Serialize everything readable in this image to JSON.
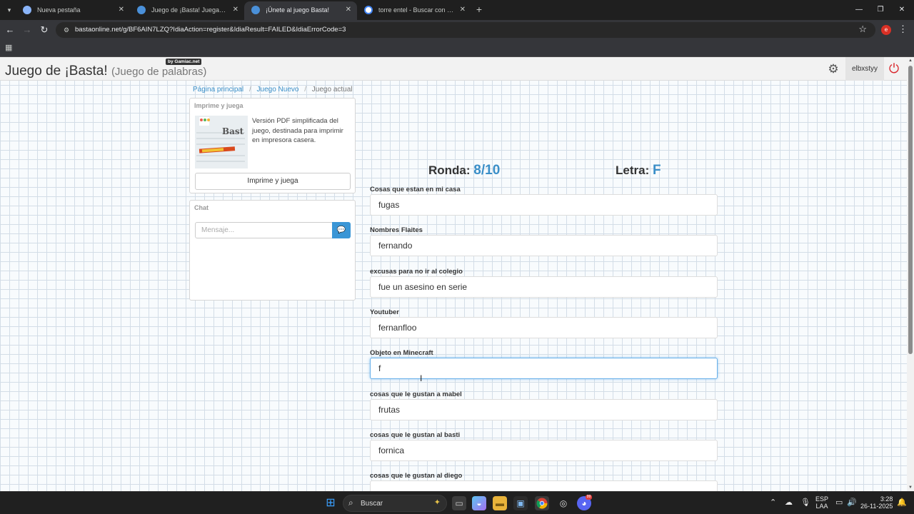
{
  "browser": {
    "tabs": [
      {
        "title": "Nueva pestaña",
        "active": false
      },
      {
        "title": "Juego de ¡Basta! Juega Stop, Tu",
        "active": false
      },
      {
        "title": "¡Únete al juego Basta!",
        "active": true
      },
      {
        "title": "torre entel - Buscar con Google",
        "active": false
      }
    ],
    "url": "bastaonline.net/g/BF6AIN7LZQ?IdiaAction=register&IdiaResult=FAILED&IdiaErrorCode=3",
    "profile_initial": "e"
  },
  "site": {
    "title": "Juego de ¡Basta!",
    "subtitle": "(Juego de palabras)",
    "badge": "by Gamiac.net",
    "username": "elbxstyy"
  },
  "breadcrumb": [
    "Página principal",
    "Juego Nuevo",
    "Juego actual"
  ],
  "print_panel": {
    "heading": "Imprime y juega",
    "description": "Versión PDF simplificada del juego, destinada para imprimir en impresora casera.",
    "button": "Imprime y juega"
  },
  "chat": {
    "heading": "Chat",
    "placeholder": "Mensaje..."
  },
  "game": {
    "round_label": "Ronda:",
    "round_value": "8/10",
    "letter_label": "Letra:",
    "letter_value": "F",
    "fields": [
      {
        "label": "Cosas que estan en mi casa",
        "value": "fugas"
      },
      {
        "label": "Nombres Flaites",
        "value": "fernando"
      },
      {
        "label": "excusas para no ir al colegio",
        "value": "fue un asesino en serie"
      },
      {
        "label": "Youtuber",
        "value": "fernanfloo"
      },
      {
        "label": "Objeto en Minecraft",
        "value": "f",
        "focused": true
      },
      {
        "label": "cosas que le gustan a mabel",
        "value": "frutas"
      },
      {
        "label": "cosas que le gustan al basti",
        "value": "fornica"
      },
      {
        "label": "cosas que le gustan al diego",
        "value": ""
      }
    ]
  },
  "taskbar": {
    "search_label": "Buscar",
    "lang_line1": "ESP",
    "lang_line2": "LAA",
    "time": "3:28",
    "date": "26-11-2025",
    "discord_badge": "99"
  },
  "colors": {
    "accent": "#3b8fc8",
    "power": "#d9262c",
    "chat_send": "#3a96d6"
  }
}
